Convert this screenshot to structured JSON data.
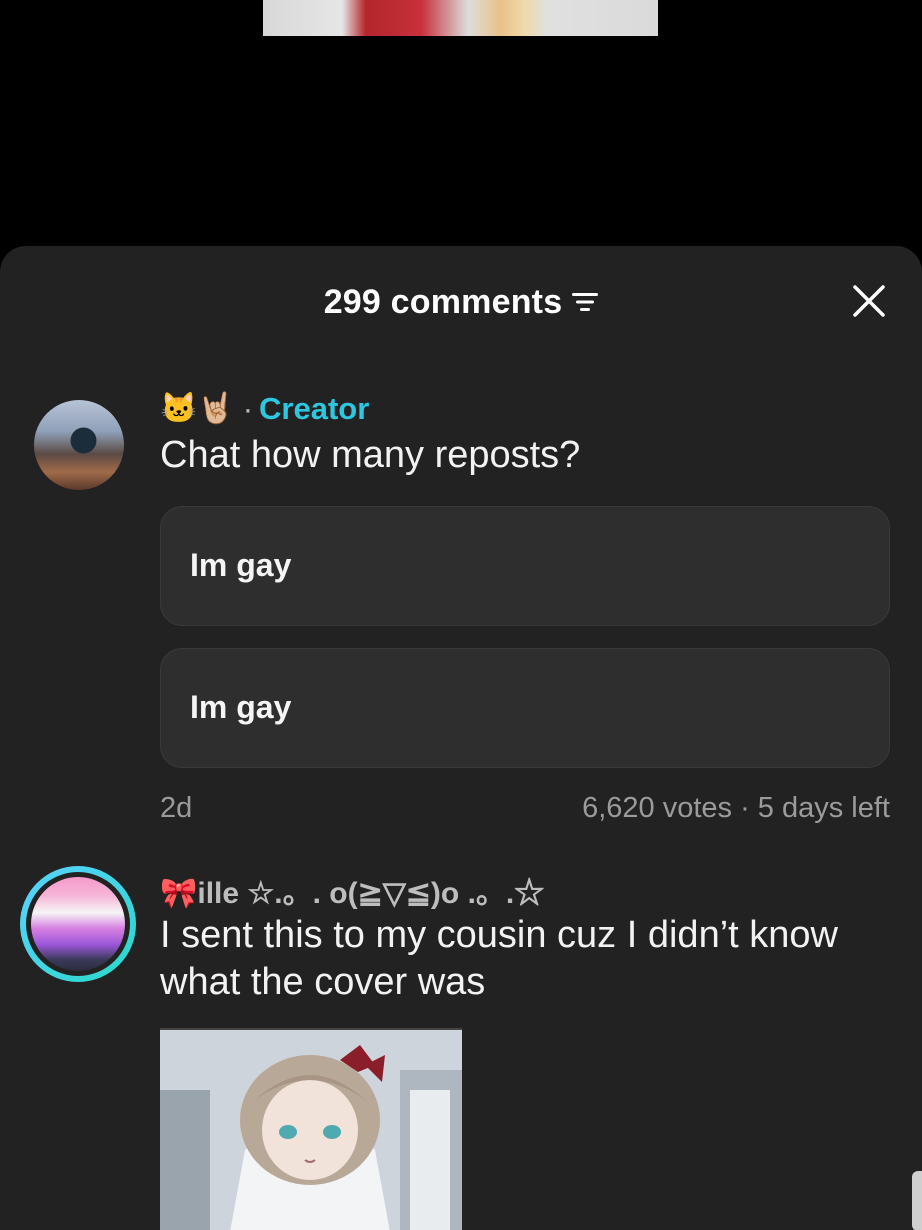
{
  "header": {
    "comments_count": "299 comments"
  },
  "comments": [
    {
      "author_emojis": "🐱🤘🏼",
      "author_separator": "·",
      "author_badge": "Creator",
      "text": "Chat how many reposts?",
      "poll": {
        "options": [
          "Im gay",
          "Im gay"
        ],
        "time": "2d",
        "votes_info": "6,620 votes · 5 days left"
      }
    },
    {
      "author_name": "🎀ille ☆.。. o(≧▽≦)o .。.☆",
      "text": "I sent this to my cousin cuz I didn’t know what the cover was"
    }
  ],
  "colors": {
    "creator_badge": "#2fc6e0",
    "sheet_background": "#222222",
    "poll_option_background": "#2e2e2e",
    "meta_text": "#9b9b9b"
  },
  "icons": {
    "filter": "filter-icon",
    "close": "close-icon"
  }
}
